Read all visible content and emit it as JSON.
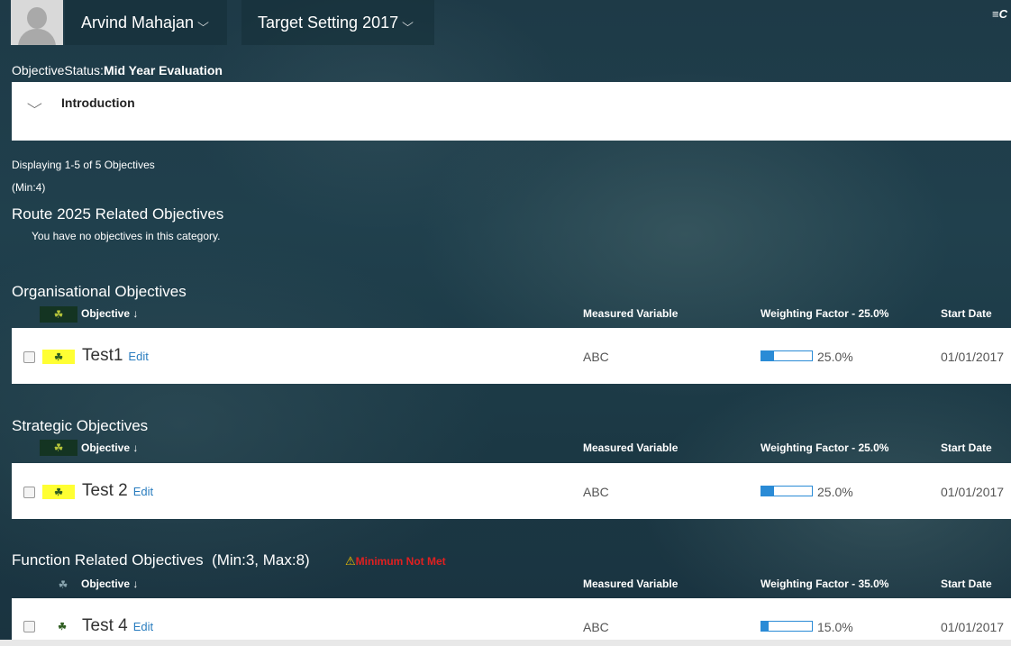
{
  "header": {
    "user_name": "Arvind Mahajan",
    "target_setting": "Target Setting 2017",
    "chevron": "⌵",
    "menu_glyph": "≡C"
  },
  "status": {
    "label": "ObjectiveStatus:",
    "value": "Mid Year Evaluation"
  },
  "introduction": {
    "title": "Introduction"
  },
  "summary": {
    "displaying": "Displaying 1-5 of 5 Objectives",
    "min": "(Min:4)"
  },
  "columns": {
    "objective": "Objective",
    "sort_arrow": "↓",
    "measured_variable": "Measured Variable",
    "start_date": "Start Date"
  },
  "sections": [
    {
      "title": "Route 2025 Related Objectives",
      "empty_message": "You have no objectives in this category."
    },
    {
      "title": "Organisational Objectives",
      "weighting": "Weighting Factor - 25.0%",
      "rows": [
        {
          "name": "Test1",
          "edit": "Edit",
          "measured_variable": "ABC",
          "progress_pct": 25,
          "progress_text": "25.0%",
          "start_date": "01/01/2017"
        }
      ]
    },
    {
      "title": "Strategic Objectives",
      "weighting": "Weighting Factor - 25.0%",
      "rows": [
        {
          "name": "Test 2",
          "edit": "Edit",
          "measured_variable": "ABC",
          "progress_pct": 25,
          "progress_text": "25.0%",
          "start_date": "01/01/2017"
        }
      ]
    },
    {
      "title": "Function Related Objectives",
      "constraint": "(Min:3, Max:8)",
      "warning": "Minimum Not Met",
      "weighting": "Weighting Factor - 35.0%",
      "rows": [
        {
          "name": "Test 4",
          "edit": "Edit",
          "measured_variable": "ABC",
          "progress_pct": 15,
          "progress_text": "15.0%",
          "start_date": "01/01/2017"
        }
      ]
    }
  ],
  "icons": {
    "avatar": "user-avatar-placeholder",
    "objective_type": "leaf-icon",
    "warning": "warning-triangle-icon"
  },
  "colors": {
    "accent_blue": "#2a8bd6",
    "highlight_yellow": "#ffff33",
    "warning_red": "#e02020",
    "background": "#1e3a47"
  }
}
